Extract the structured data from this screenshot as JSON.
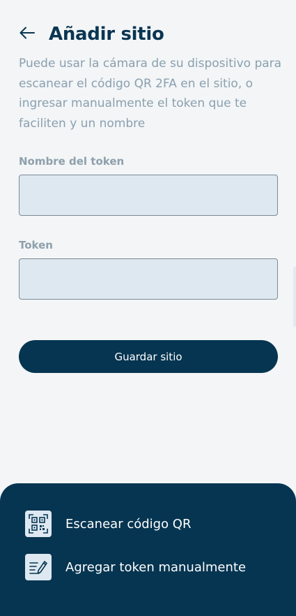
{
  "header": {
    "title": "Añadir sitio",
    "back_icon": "arrow-left-icon"
  },
  "description": "Puede usar la cámara de su dispositivo para escanear el código QR 2FA en el sitio, o ingresar manualmente el token que te faciliten y un nombre",
  "form": {
    "token_name_label": "Nombre del token",
    "token_name_value": "",
    "token_label": "Token",
    "token_value": "",
    "save_label": "Guardar sitio"
  },
  "bottom_sheet": {
    "items": [
      {
        "label": "Escanear código QR",
        "icon": "qr-code-icon"
      },
      {
        "label": "Agregar token manualmente",
        "icon": "edit-list-icon"
      }
    ]
  },
  "colors": {
    "primary": "#063551",
    "background": "#f3f5f7",
    "input_fill": "#dde8f1",
    "muted_text": "#8aa0ae"
  }
}
